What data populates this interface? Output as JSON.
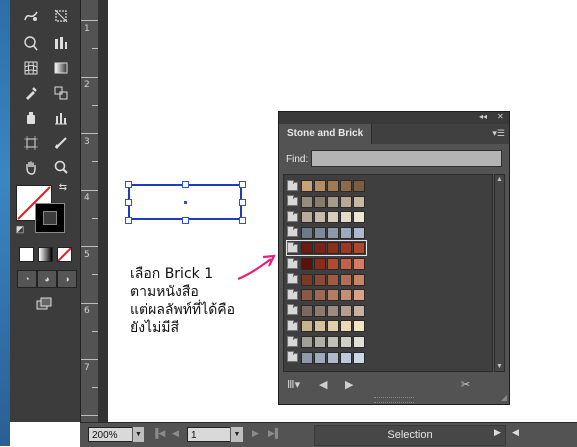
{
  "ruler": {
    "numbers": [
      "1",
      "2",
      "3",
      "4",
      "5",
      "6",
      "7"
    ]
  },
  "tools": {
    "icons": [
      "warp-icon",
      "free-transform-icon",
      "shape-builder-icon",
      "graph-icon",
      "mesh-icon",
      "gradient-icon",
      "eyedropper-icon",
      "blend-icon",
      "symbol-sprayer-icon",
      "column-graph-icon",
      "artboard-icon",
      "slice-icon",
      "hand-icon",
      "zoom-icon"
    ]
  },
  "colors": {
    "fill": "#ffffff",
    "stroke": "#000000"
  },
  "annotation": {
    "line1": "เลือก Brick 1",
    "line2": "ตามหนังสือ",
    "line3": "แต่ผลลัพท์ที่ได้คือ",
    "line4": "ยังไม่มีสี"
  },
  "panel": {
    "tab_label": "Stone and Brick",
    "find_label": "Find:",
    "find_value": "",
    "swatch_groups": [
      {
        "colors": [
          "#c9a27a",
          "#b58c64",
          "#a07a56",
          "#8c6a4a",
          "#7a5c40"
        ],
        "selected": false
      },
      {
        "colors": [
          "#9a8c7c",
          "#8a7c6c",
          "#a89a88",
          "#b8a894",
          "#c6b8a2"
        ],
        "selected": false
      },
      {
        "colors": [
          "#b8ab99",
          "#c7bca9",
          "#d6ccb9",
          "#e3dac8",
          "#ede6d6"
        ],
        "selected": false
      },
      {
        "colors": [
          "#6c7a8c",
          "#7c8a9c",
          "#8c9aac",
          "#9caabc",
          "#acbacc"
        ],
        "selected": false
      },
      {
        "colors": [
          "#6b1a10",
          "#7a2416",
          "#8c2e1c",
          "#9c3a24",
          "#b0482c"
        ],
        "selected": true
      },
      {
        "colors": [
          "#5a1208",
          "#8c2a1a",
          "#b04a30",
          "#c46248",
          "#d87a60"
        ],
        "selected": false
      },
      {
        "colors": [
          "#7a3a24",
          "#8c4a32",
          "#a05c42",
          "#b46e52",
          "#c88266"
        ],
        "selected": false
      },
      {
        "colors": [
          "#8c5a44",
          "#a06a52",
          "#b47c62",
          "#c88e74",
          "#dca088"
        ],
        "selected": false
      },
      {
        "colors": [
          "#7a6a60",
          "#8c7a6e",
          "#a08c7e",
          "#b49e90",
          "#c8b2a4"
        ],
        "selected": false
      },
      {
        "colors": [
          "#c8b48c",
          "#d6c29a",
          "#e2cfa8",
          "#ecdab6",
          "#f4e4c4"
        ],
        "selected": false
      },
      {
        "colors": [
          "#a0a098",
          "#b0b0a8",
          "#c0c0b8",
          "#d0d0c8",
          "#e0e0d8"
        ],
        "selected": false
      },
      {
        "colors": [
          "#8c9aac",
          "#9caabc",
          "#acbacc",
          "#bccadc",
          "#ccd8e8"
        ],
        "selected": false
      }
    ]
  },
  "status": {
    "zoom_value": "200%",
    "page_value": "1",
    "mode_label": "Selection"
  }
}
